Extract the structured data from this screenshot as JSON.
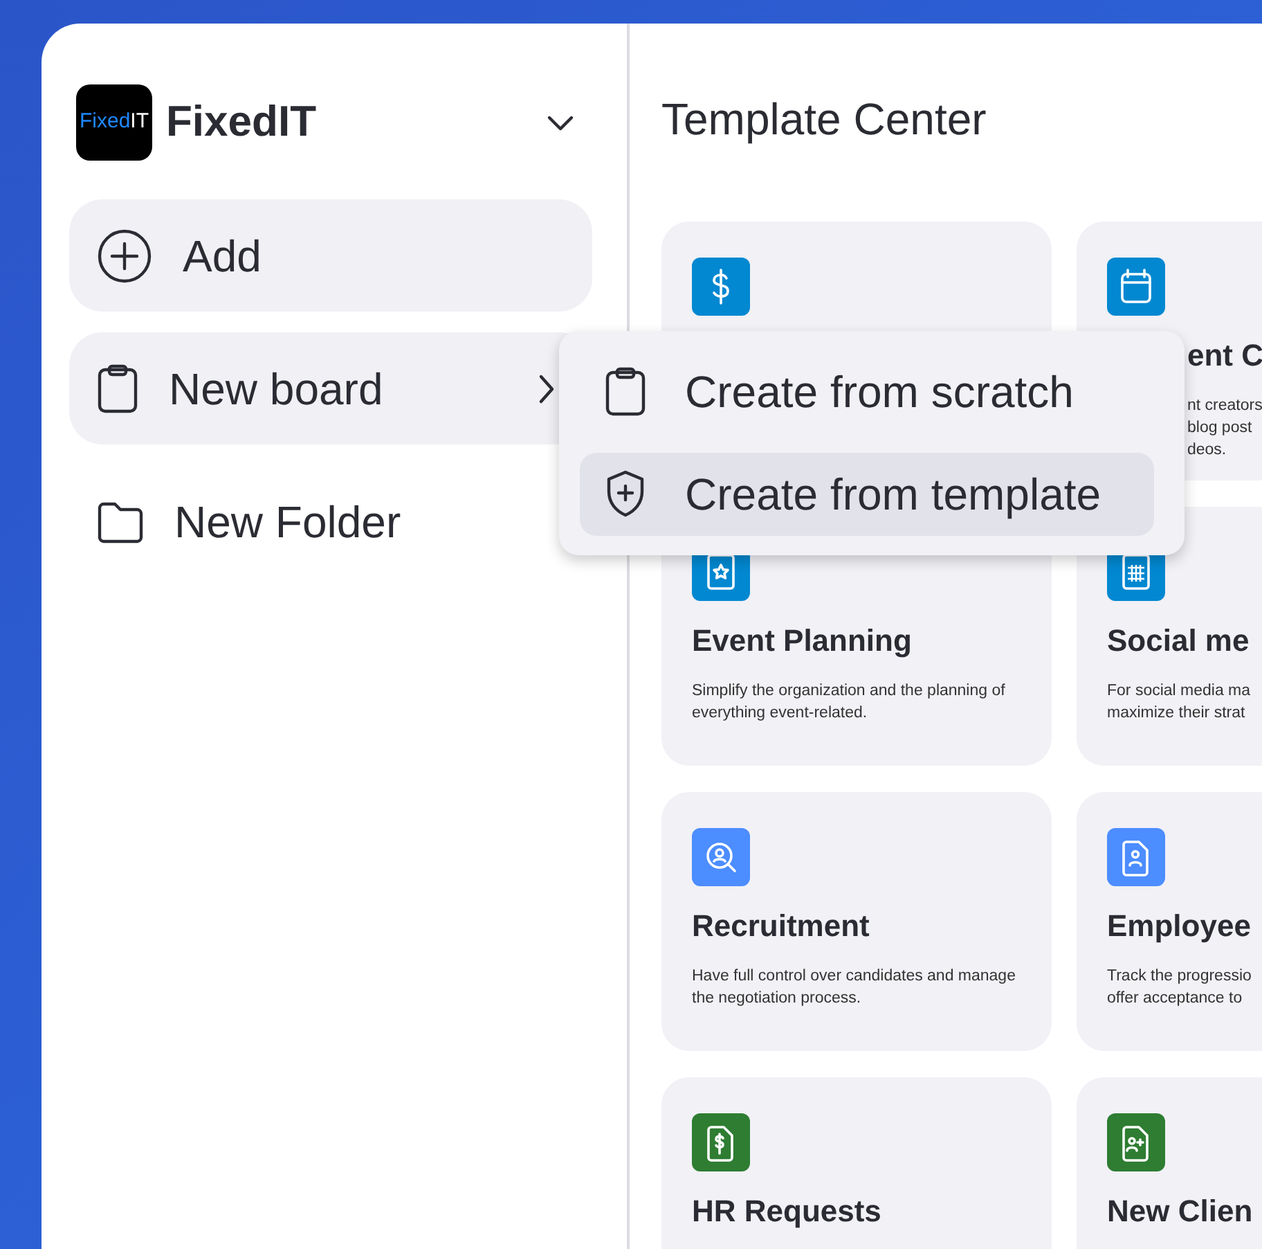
{
  "sidebar": {
    "logo": {
      "parts": [
        "Fixed",
        "IT"
      ]
    },
    "workspace": "FixedIT",
    "items": [
      {
        "kind": "add",
        "label": "Add"
      },
      {
        "kind": "board",
        "label": "New board",
        "selected": true
      },
      {
        "kind": "folder",
        "label": "New Folder",
        "selected": false
      }
    ]
  },
  "main": {
    "title": "Template Center",
    "cards": [
      {
        "kind": "dollar",
        "color": "#0288d1"
      },
      {
        "kind": "calendar",
        "color": "#0288d1",
        "covered": true,
        "title": "ent C",
        "description": "nt creators\nblog post\ndeos."
      },
      {
        "kind": "calendar-star",
        "color": "#0288d1",
        "covered": false,
        "title": "Event Planning",
        "description": "Simplify the organization and the planning of everything event-related."
      },
      {
        "kind": "calendar-grid",
        "color": "#0288d1",
        "covered": false,
        "title": "Social me",
        "description": "For social media ma\nmaximize their strat"
      },
      {
        "kind": "user-search",
        "color": "#4c8dff",
        "covered": false,
        "title": "Recruitment",
        "description": "Have full control over candidates and manage the negotiation process."
      },
      {
        "kind": "user-document",
        "color": "#4c8dff",
        "covered": false,
        "title": "Employee",
        "description": "Track the progressio\noffer acceptance to"
      },
      {
        "kind": "dollar-document",
        "color": "#2e7d32",
        "covered": false,
        "title": "HR Requests"
      },
      {
        "kind": "user-plus-document",
        "color": "#2e7d32",
        "covered": false,
        "title": "New Clien"
      }
    ]
  },
  "menu": {
    "items": [
      {
        "kind": "clipboard",
        "label": "Create from scratch",
        "selected": false
      },
      {
        "kind": "shield",
        "label": "Create from template",
        "selected": true
      }
    ]
  }
}
